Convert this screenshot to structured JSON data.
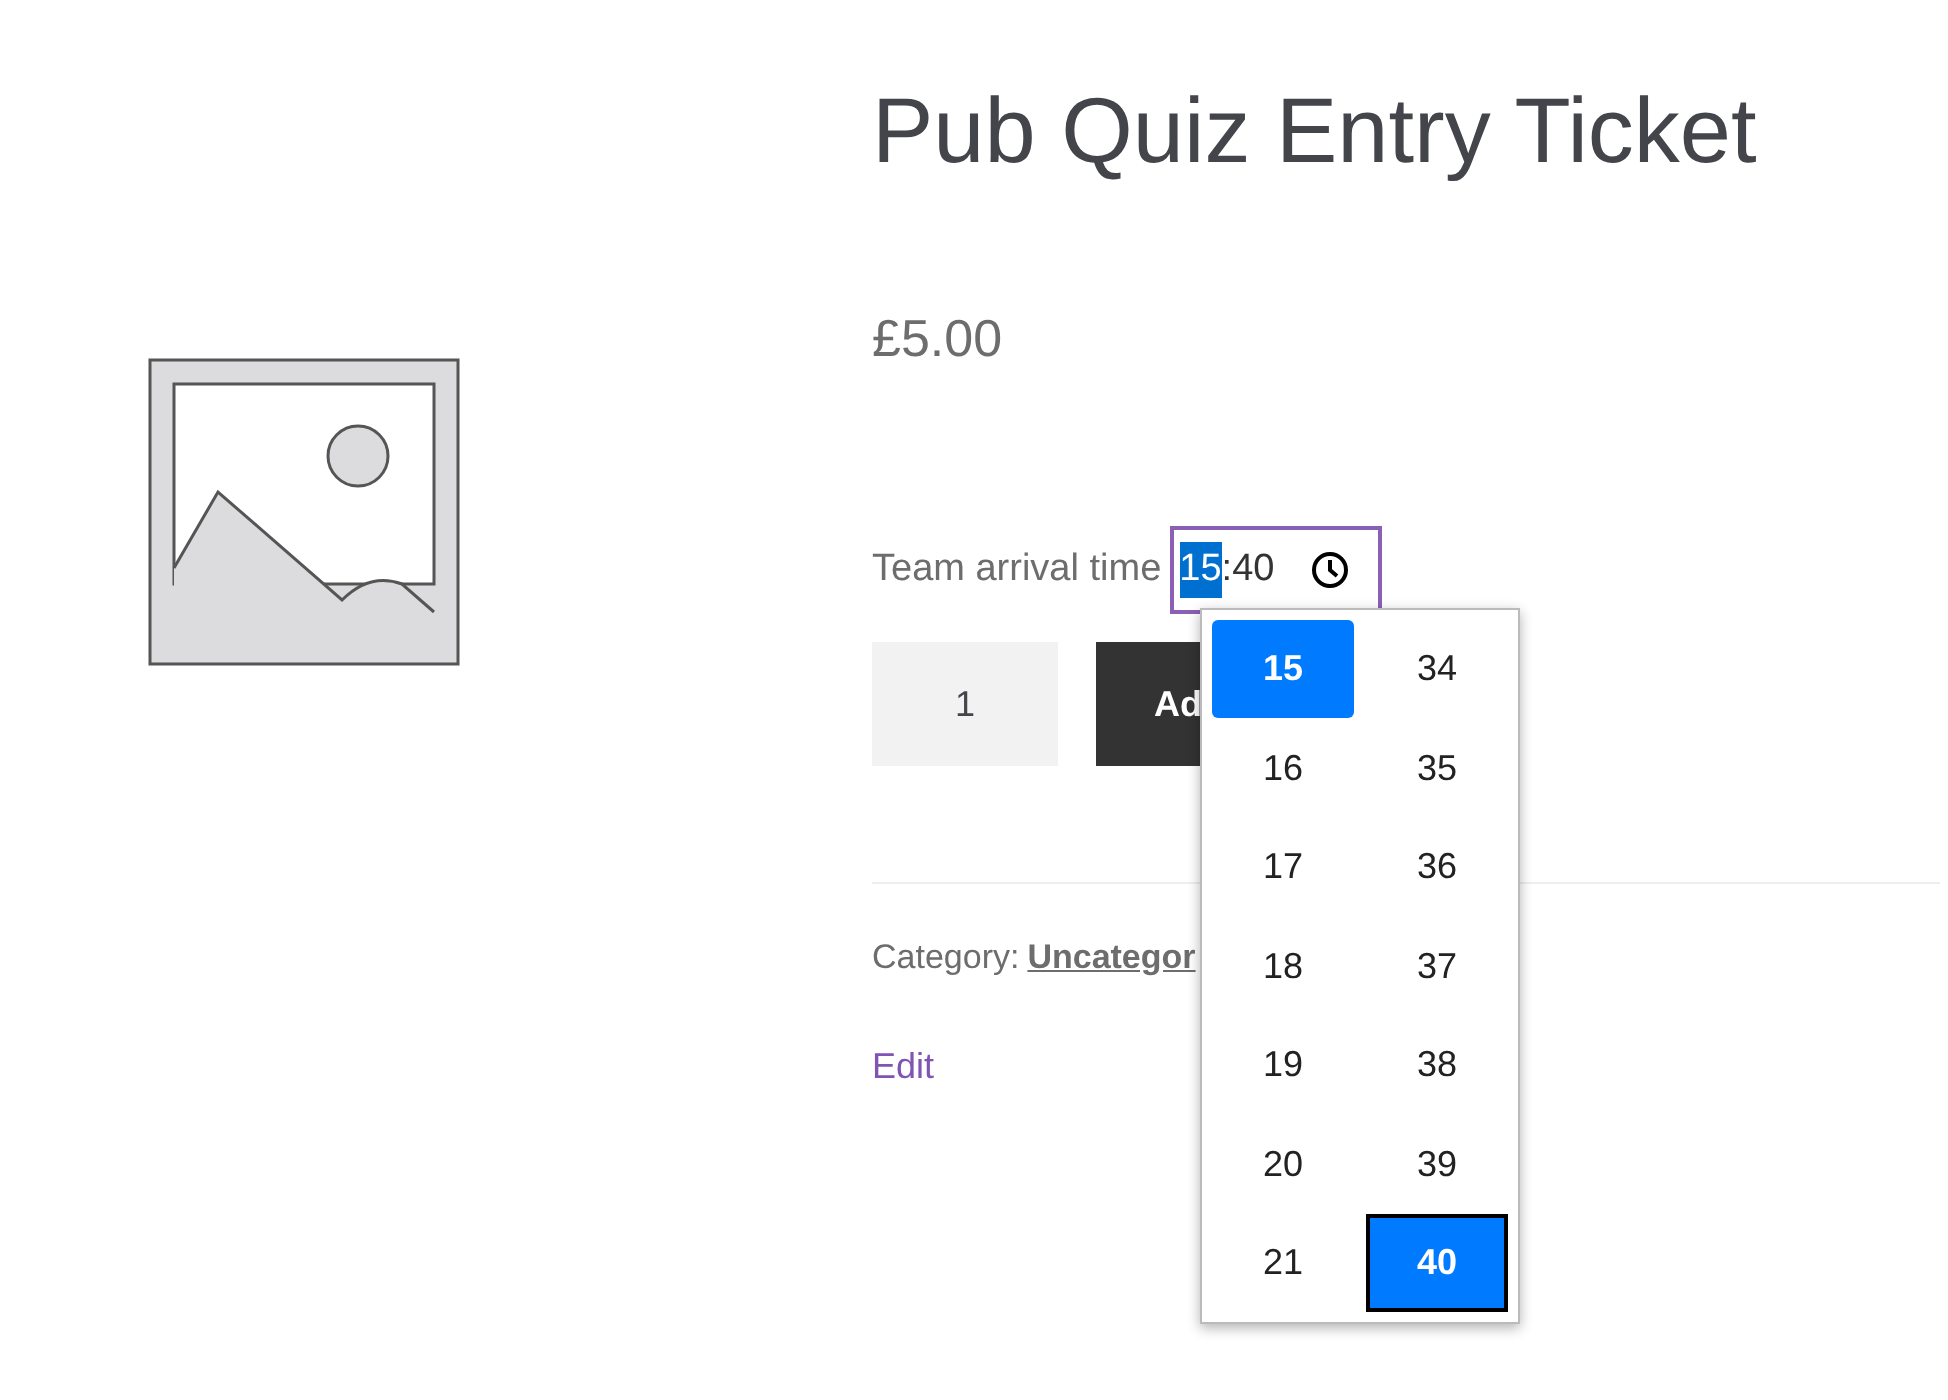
{
  "product": {
    "title": "Pub Quiz Entry Ticket",
    "price": "£5.00",
    "time_field": {
      "label": "Team arrival time",
      "hour": "15",
      "separator": ":",
      "minute": "40",
      "hour_selected": true
    },
    "quantity": "1",
    "add_button": "Ad",
    "category_label": "Category:",
    "category_link": "Uncategor",
    "edit_link": "Edit"
  },
  "time_picker": {
    "hours": [
      {
        "label": "15",
        "selected": true
      },
      {
        "label": "16",
        "selected": false
      },
      {
        "label": "17",
        "selected": false
      },
      {
        "label": "18",
        "selected": false
      },
      {
        "label": "19",
        "selected": false
      },
      {
        "label": "20",
        "selected": false
      },
      {
        "label": "21",
        "selected": false
      }
    ],
    "minutes": [
      {
        "label": "34",
        "selected": false
      },
      {
        "label": "35",
        "selected": false
      },
      {
        "label": "36",
        "selected": false
      },
      {
        "label": "37",
        "selected": false
      },
      {
        "label": "38",
        "selected": false
      },
      {
        "label": "39",
        "selected": false
      },
      {
        "label": "40",
        "selected": true
      }
    ]
  }
}
